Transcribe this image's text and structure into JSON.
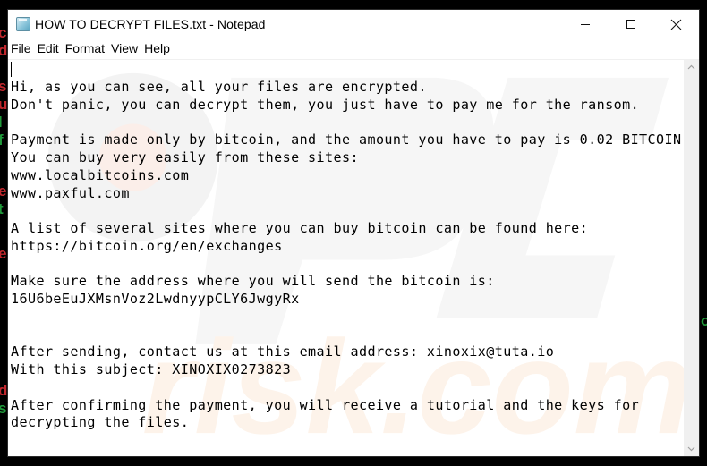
{
  "window": {
    "title": "HOW TO DECRYPT FILES.txt - Notepad",
    "app_icon": "notepad-icon",
    "controls": {
      "minimize": "minimize-icon",
      "maximize": "maximize-icon",
      "close": "close-icon"
    }
  },
  "menu": {
    "items": [
      {
        "label": "File"
      },
      {
        "label": "Edit"
      },
      {
        "label": "Format"
      },
      {
        "label": "View"
      },
      {
        "label": "Help"
      }
    ]
  },
  "document": {
    "lines": [
      "Hi, as you can see, all your files are encrypted.",
      "Don't panic, you can decrypt them, you just have to pay me for the ransom.",
      "",
      "Payment is made only by bitcoin, and the amount you have to pay is 0.02 BITCOIN",
      "You can buy very easily from these sites:",
      "www.localbitcoins.com",
      "www.paxful.com",
      "",
      "A list of several sites where you can buy bitcoin can be found here:",
      "https://bitcoin.org/en/exchanges",
      "",
      "Make sure the address where you will send the bitcoin is:",
      "16U6beEuJXMsnVoz2LwdnyypCLY6JwgyRx",
      "",
      "",
      "After sending, contact us at this email address: xinoxix@tuta.io",
      "With this subject: XINOXIX0273823",
      "",
      "After confirming the payment, you will receive a tutorial and the keys for",
      "decrypting the files."
    ]
  },
  "scrollbar": {
    "up_icon": "chevron-up-icon",
    "down_icon": "chevron-down-icon"
  },
  "watermark": {
    "text_top": "PC",
    "text_bottom": "risk.com"
  },
  "background_glyphs": [
    {
      "char": "c",
      "color": "#c0272d"
    },
    {
      "char": "d",
      "color": "#c0272d"
    },
    {
      "char": "s",
      "color": "#c0272d"
    },
    {
      "char": "u",
      "color": "#c0272d"
    },
    {
      "char": "l",
      "color": "#1f9a3a"
    },
    {
      "char": "f",
      "color": "#1f9a3a"
    },
    {
      "char": "e",
      "color": "#c0272d"
    },
    {
      "char": "t",
      "color": "#1f9a3a"
    },
    {
      "char": "e",
      "color": "#c0272d"
    },
    {
      "char": "d",
      "color": "#c0272d"
    },
    {
      "char": "s",
      "color": "#1f9a3a"
    }
  ],
  "colors": {
    "desktop": "#000000",
    "window_bg": "#ffffff",
    "scrollbar_bg": "#f0f0f0",
    "text": "#000000"
  }
}
